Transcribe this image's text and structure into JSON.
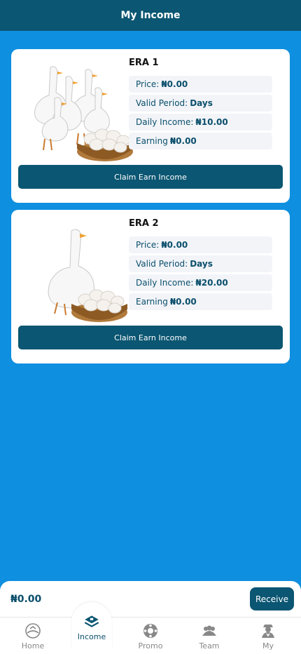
{
  "header": {
    "title": "My Income"
  },
  "cards": [
    {
      "title": "ERA 1",
      "price_label": "Price:",
      "price_value": "₦0.00",
      "period_label": "Valid Period:",
      "period_value": "Days",
      "daily_label": "Daily Income:",
      "daily_value": "₦10.00",
      "earning_label": "Earning",
      "earning_value": "₦0.00",
      "button": "Claim Earn Income"
    },
    {
      "title": "ERA 2",
      "price_label": "Price:",
      "price_value": "₦0.00",
      "period_label": "Valid Period:",
      "period_value": "Days",
      "daily_label": "Daily Income:",
      "daily_value": "₦20.00",
      "earning_label": "Earning",
      "earning_value": "₦0.00",
      "button": "Claim Earn Income"
    }
  ],
  "bottom": {
    "balance": "₦0.00",
    "receive": "Receive"
  },
  "nav": [
    {
      "label": "Home",
      "icon": "home-icon"
    },
    {
      "label": "Income",
      "icon": "income-icon"
    },
    {
      "label": "Promo",
      "icon": "promo-icon"
    },
    {
      "label": "Team",
      "icon": "team-icon"
    },
    {
      "label": "My",
      "icon": "profile-icon"
    }
  ],
  "colors": {
    "primary": "#0b5672",
    "background": "#0f8fe0",
    "card": "#ffffff"
  }
}
